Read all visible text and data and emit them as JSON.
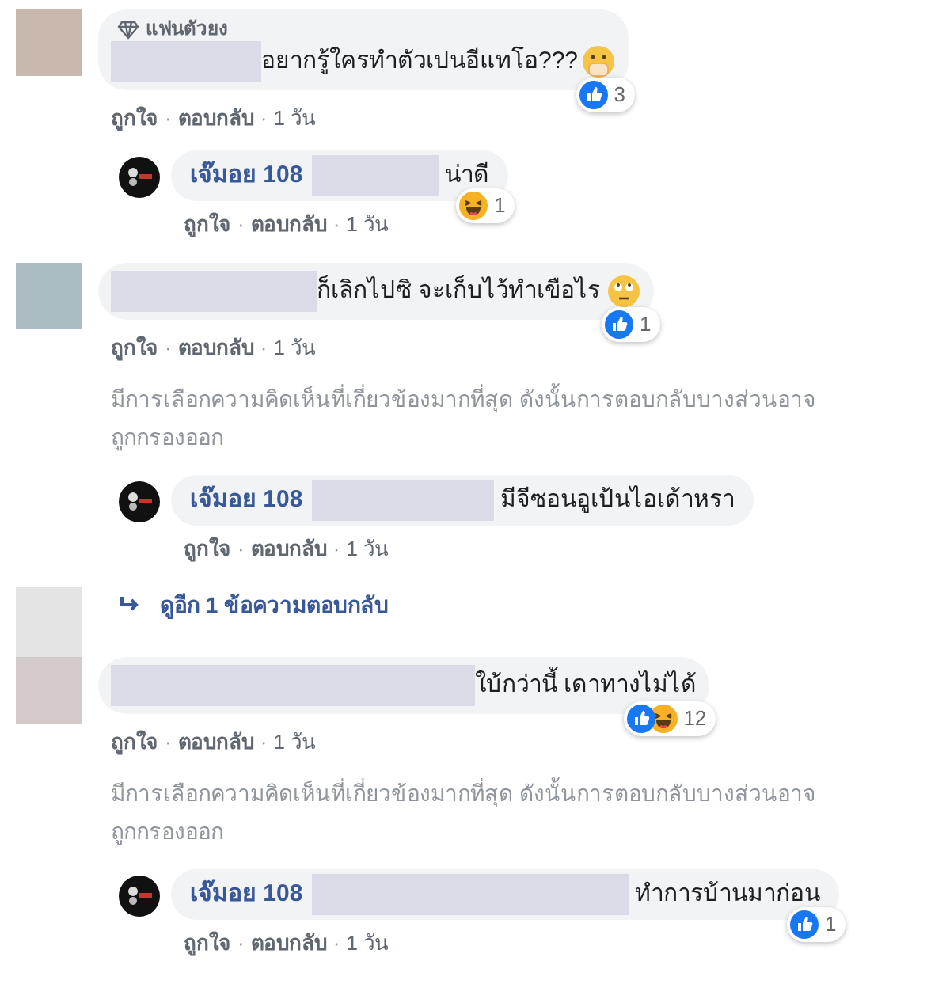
{
  "comments": [
    {
      "kind": "comment",
      "color": "#c9b8ae",
      "badge": "แฟนตัวยง",
      "name_redacted": true,
      "text": "อยากรู้ใครทำตัวเปนอีแทโอ???",
      "emoji": {
        "kind": "hand-over-mouth"
      },
      "reactions": {
        "kinds": [
          {
            "kind": "like"
          }
        ],
        "count": "3"
      },
      "actions": [
        "ถูกใจ",
        "·",
        "ตอบกลับ",
        "·",
        "1 วัน"
      ],
      "replies": [
        {
          "name": "เจ๊มอย 108",
          "name_redacted": true,
          "text": "น่าดี",
          "reactions": {
            "kinds": [
              {
                "kind": "haha"
              }
            ],
            "count": "1"
          },
          "actions": [
            "ถูกใจ",
            "·",
            "ตอบกลับ",
            "·",
            "1 วัน"
          ]
        }
      ]
    },
    {
      "kind": "comment",
      "color": "#abbdc1",
      "name_redacted": true,
      "text": "ก็เลิกไปซิ จะเก็บไว้ทำเขือไร",
      "emoji": {
        "kind": "eye-roll"
      },
      "reactions": {
        "kinds": [
          {
            "kind": "like"
          }
        ],
        "count": "1"
      },
      "actions": [
        "ถูกใจ",
        "·",
        "ตอบกลับ",
        "·",
        "1 วัน"
      ],
      "notice": "มีการเลือกความคิดเห็นที่เกี่ยวข้องมากที่สุด ดังนั้นการตอบกลับบางส่วนอาจถูกกรองออก",
      "replies": [
        {
          "name": "เจ๊มอย 108",
          "name_redacted": true,
          "text": "มีจีซอนอูเป้นไอเด้าหรา",
          "actions": [
            "ถูกใจ",
            "·",
            "ตอบกลับ",
            "·",
            "1 วัน"
          ]
        }
      ]
    },
    {
      "kind": "more",
      "color": "#e4e4e4",
      "text": "ดูอีก 1 ข้อความตอบกลับ"
    },
    {
      "kind": "comment",
      "color": "#d2cbca",
      "name_redacted": true,
      "text": "ใบ้กว่านี้ เดาทางไม่ได้",
      "reactions": {
        "kinds": [
          {
            "kind": "like"
          },
          {
            "kind": "haha"
          }
        ],
        "count": "12"
      },
      "actions": [
        "ถูกใจ",
        "·",
        "ตอบกลับ",
        "·",
        "1 วัน"
      ],
      "notice": "มีการเลือกความคิดเห็นที่เกี่ยวข้องมากที่สุด ดังนั้นการตอบกลับบางส่วนอาจถูกกรองออก",
      "replies": [
        {
          "name": "เจ๊มอย 108",
          "name_redacted": true,
          "text": "ทำการบ้านมาก่อน",
          "reactions": {
            "kinds": [
              {
                "kind": "like"
              }
            ],
            "count": "1"
          },
          "actions": [
            "ถูกใจ",
            "·",
            "ตอบกลับ",
            "·",
            "1 วัน"
          ]
        }
      ]
    }
  ]
}
